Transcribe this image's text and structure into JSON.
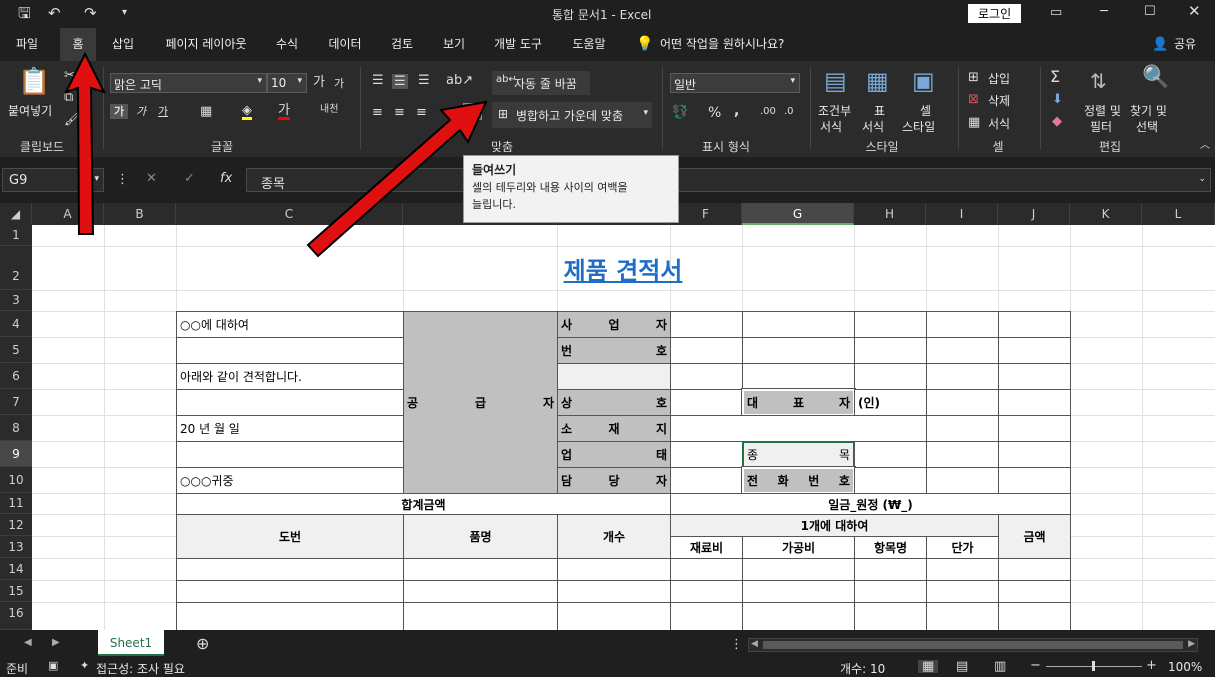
{
  "titlebar": {
    "title": "통합 문서1  -  Excel",
    "login": "로그인"
  },
  "menu": [
    "파일",
    "홈",
    "삽입",
    "페이지 레이아웃",
    "수식",
    "데이터",
    "검토",
    "보기",
    "개발 도구",
    "도움말"
  ],
  "tell_me": "어떤 작업을 원하시나요?",
  "share": "공유",
  "ribbon": {
    "clipboard": {
      "paste": "붙여넣기",
      "label": "클립보드"
    },
    "font": {
      "name": "맑은 고딕",
      "size": "10",
      "label": "글꼴"
    },
    "align": {
      "wrap": "자동 줄 바꿈",
      "merge": "병합하고 가운데 맞춤",
      "label": "맞춤"
    },
    "number": {
      "format": "일반",
      "label": "표시 형식"
    },
    "styles": {
      "cond": "조건부",
      "cond2": "서식",
      "table": "표",
      "table2": "서식",
      "cell": "셀",
      "cell2": "스타일",
      "label": "스타일"
    },
    "cells": {
      "insert": "삽입",
      "delete": "삭제",
      "format": "서식",
      "label": "셀"
    },
    "edit": {
      "sort": "정렬 및",
      "sort2": "필터",
      "find": "찾기 및",
      "find2": "선택",
      "label": "편집"
    }
  },
  "formula": {
    "namebox": "G9",
    "fx": "fx",
    "value": "종목"
  },
  "tooltip": {
    "title": "들여쓰기",
    "body1": "셀의 테두리와 내용 사이의 여백을",
    "body2": "늘립니다."
  },
  "columns": [
    "A",
    "B",
    "C",
    "D",
    "E",
    "F",
    "G",
    "H",
    "I",
    "J",
    "K",
    "L"
  ],
  "rows": [
    "1",
    "2",
    "3",
    "4",
    "5",
    "6",
    "7",
    "8",
    "9",
    "10",
    "11",
    "12",
    "13",
    "14",
    "15",
    "16"
  ],
  "sheet": {
    "title": "제품 견적서",
    "c4": "○○에 대하여",
    "c6": "아래와 같이 견적합니다.",
    "c8": "20 년 월 일",
    "c10": "○○○귀중",
    "supplier": [
      "공",
      "급",
      "자"
    ],
    "e4": [
      "사",
      "업",
      "자"
    ],
    "e5": [
      "번",
      "호"
    ],
    "e7": [
      "상",
      "호"
    ],
    "e8": [
      "소",
      "재",
      "지"
    ],
    "e9": [
      "업",
      "태"
    ],
    "e10": [
      "담",
      "당",
      "자"
    ],
    "g7": [
      "대",
      "표",
      "자"
    ],
    "h7": "(인)",
    "g9": [
      "종",
      "목"
    ],
    "g10": [
      "전",
      "화",
      "번",
      "호"
    ],
    "total": "합계금액",
    "won": "일금_원정 (₩_)",
    "dobun": "도번",
    "pummyeong": "품명",
    "count": "개수",
    "per1": "1개에 대하여",
    "amount": "금액",
    "material": "재료비",
    "process": "가공비",
    "item": "항목명",
    "unit": "단가"
  },
  "tab": {
    "sheet": "Sheet1"
  },
  "status": {
    "ready": "준비",
    "access": "접근성: 조사 필요",
    "count": "개수: 10",
    "zoom": "100%"
  }
}
